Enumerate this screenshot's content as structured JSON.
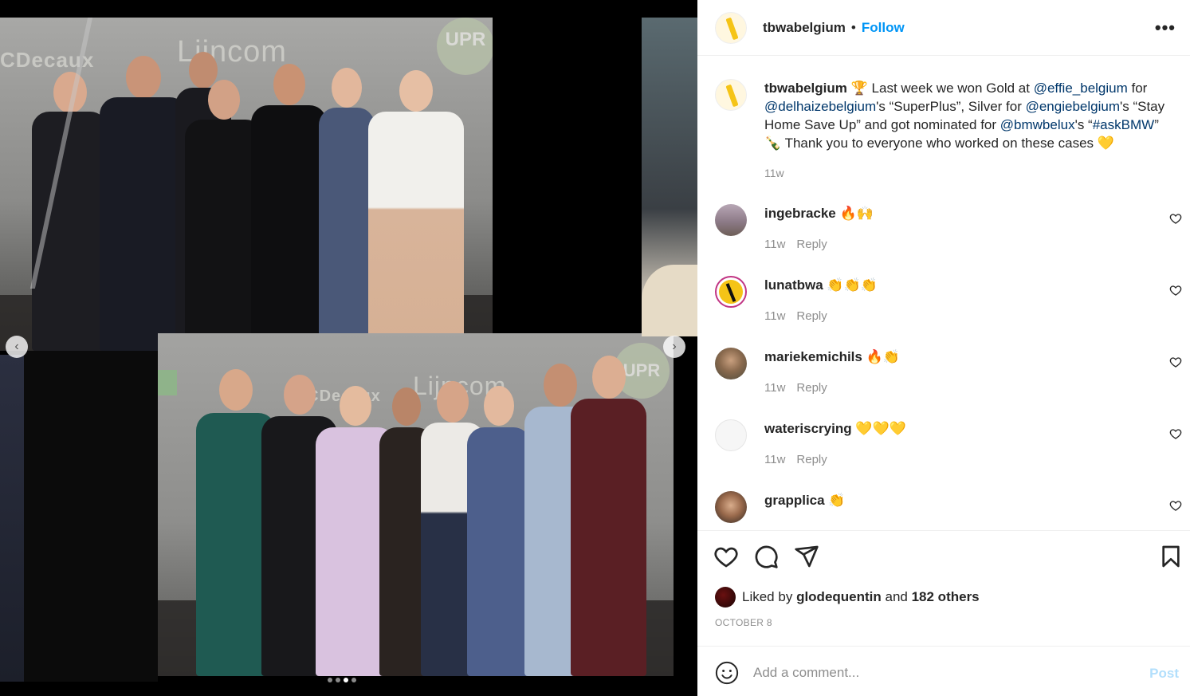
{
  "media": {
    "top_photo_logos": [
      "CDecaux",
      "Lijncom",
      "UPR"
    ],
    "bottom_photo_logos": [
      "JCDecaux",
      "Lijncom",
      "UPR"
    ],
    "carousel": {
      "total": 4,
      "active": 3
    },
    "prev_icon": "chevron-left-icon",
    "next_icon": "chevron-right-icon"
  },
  "header": {
    "username": "tbwabelgium",
    "separator": "•",
    "follow_label": "Follow",
    "more_label": "•••"
  },
  "caption": {
    "username": "tbwabelgium",
    "emoji_1": "🏆",
    "text_1": " Last week we won Gold at ",
    "mention_1": "@effie_belgium",
    "text_2": " for ",
    "mention_2": "@delhaizebelgium",
    "text_3": "'s “SuperPlus”, Silver for ",
    "mention_3": "@engiebelgium",
    "text_4": "'s “Stay Home Save Up” and got nominated for ",
    "mention_4": "@bmwbelux",
    "text_5": "'s “",
    "mention_5": "#askBMW",
    "text_6": "” ",
    "emoji_2": "🍾",
    "text_7": " Thank you to everyone who worked on these cases ",
    "emoji_3": "💛",
    "time": "11w"
  },
  "comments": [
    {
      "username": "ingebracke",
      "text": "🔥🙌",
      "time": "11w",
      "reply": "Reply"
    },
    {
      "username": "lunatbwa",
      "text": "👏👏👏",
      "time": "11w",
      "reply": "Reply"
    },
    {
      "username": "mariekemichils",
      "text": "🔥👏",
      "time": "11w",
      "reply": "Reply"
    },
    {
      "username": "wateriscrying",
      "text": "💛💛💛",
      "time": "11w",
      "reply": "Reply"
    },
    {
      "username": "grapplica",
      "text": "👏",
      "time": "",
      "reply": ""
    }
  ],
  "likes": {
    "prefix": "Liked by ",
    "user": "glodequentin",
    "middle": " and ",
    "others": "182 others"
  },
  "date": "OCTOBER 8",
  "add_comment": {
    "placeholder": "Add a comment...",
    "post_label": "Post"
  },
  "colors": {
    "accent": "#0095f6",
    "post_disabled": "#b2dffc",
    "muted": "#8e8e8e",
    "brand_yellow": "#f5c417"
  }
}
